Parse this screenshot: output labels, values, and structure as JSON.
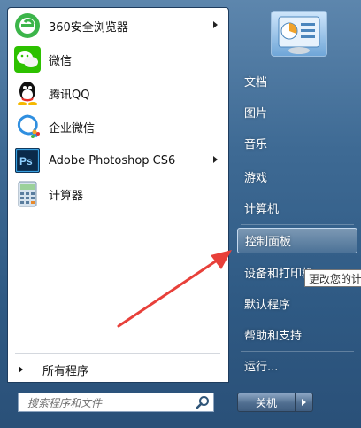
{
  "programs": [
    {
      "label": "360安全浏览器",
      "icon": "360-browser-icon",
      "has_submenu": true
    },
    {
      "label": "微信",
      "icon": "wechat-icon",
      "has_submenu": false
    },
    {
      "label": "腾讯QQ",
      "icon": "qq-icon",
      "has_submenu": false
    },
    {
      "label": "企业微信",
      "icon": "wecom-icon",
      "has_submenu": false
    },
    {
      "label": "Adobe Photoshop CS6",
      "icon": "photoshop-icon",
      "has_submenu": true
    },
    {
      "label": "计算器",
      "icon": "calculator-icon",
      "has_submenu": false
    }
  ],
  "all_programs_label": "所有程序",
  "search": {
    "placeholder": "搜索程序和文件"
  },
  "right_menu": [
    {
      "label": "文档"
    },
    {
      "label": "图片"
    },
    {
      "label": "音乐"
    },
    {
      "label": "游戏"
    },
    {
      "label": "计算机"
    },
    {
      "label": "控制面板",
      "highlighted": true
    },
    {
      "label": "设备和打印机"
    },
    {
      "label": "默认程序"
    },
    {
      "label": "帮助和支持"
    },
    {
      "label": "运行..."
    }
  ],
  "tooltip": "更改您的计",
  "shutdown": {
    "label": "关机"
  },
  "colors": {
    "accent_arrow": "#e8403a",
    "menu_bg": "#3e6a94"
  }
}
